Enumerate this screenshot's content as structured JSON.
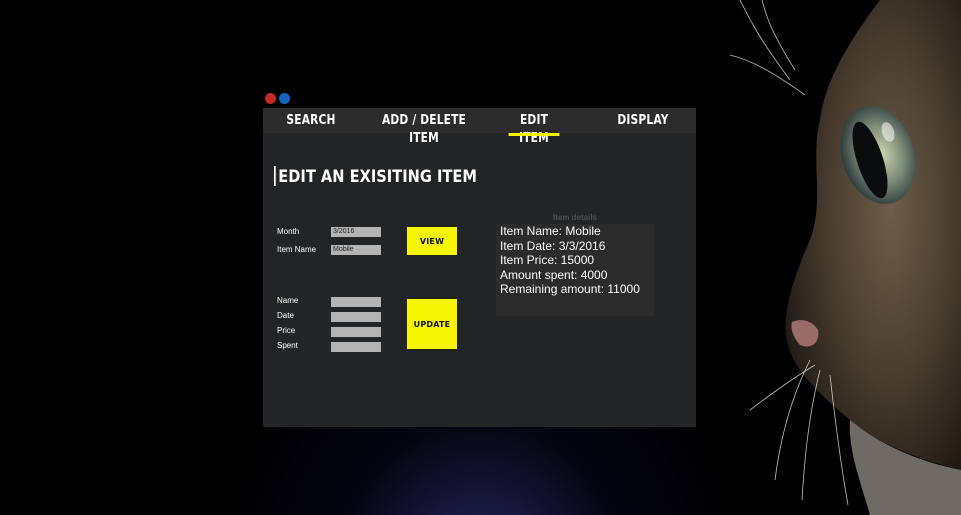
{
  "window_controls": {
    "close_color": "#c62828",
    "minimize_color": "#1565c0"
  },
  "tabs": [
    {
      "label": "SEARCH",
      "active": false
    },
    {
      "label": "ADD / DELETE ITEM",
      "active": false
    },
    {
      "label": "EDIT ITEM",
      "active": true
    },
    {
      "label": "DISPLAY",
      "active": false
    }
  ],
  "page_title": "EDIT AN EXISITING ITEM",
  "lookup_form": {
    "month_label": "Month",
    "month_value": "3/2016",
    "item_name_label": "Item Name",
    "item_name_value": "Mobile",
    "view_button": "VIEW"
  },
  "edit_form": {
    "name_label": "Name",
    "name_value": "",
    "date_label": "Date",
    "date_value": "",
    "price_label": "Price",
    "price_value": "",
    "spent_label": "Spent",
    "spent_value": "",
    "update_button": "UPDATE"
  },
  "details": {
    "caption": "Item details",
    "lines": [
      "Item Name: Mobile",
      "Item Date: 3/3/2016",
      "Item Price: 15000",
      "Amount spent: 4000",
      "Remaining amount: 11000"
    ]
  },
  "colors": {
    "accent": "#f6f600",
    "window_bg": "#232425",
    "tabbar_bg": "#2c2c2c",
    "field_bg": "#b4b4b4"
  },
  "background_icon": "cat-wallpaper"
}
